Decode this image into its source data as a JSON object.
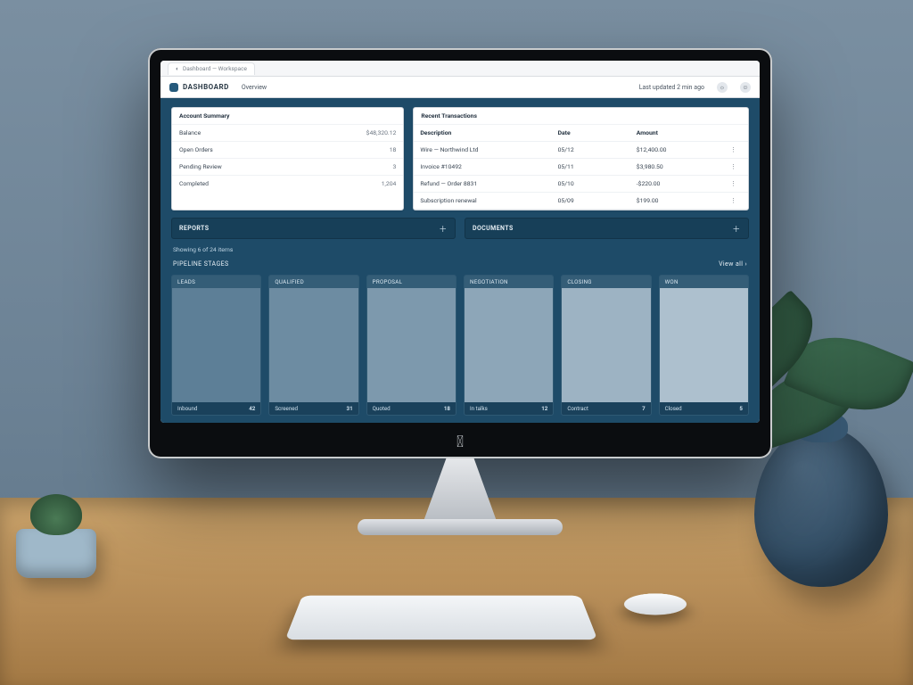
{
  "browser": {
    "tab_title": "Dashboard — Workspace"
  },
  "appbar": {
    "brand": "DASHBOARD",
    "nav1": "Overview",
    "status_text": "Last updated 2 min ago"
  },
  "summary_card": {
    "title": "Account Summary",
    "rows": [
      {
        "k": "Balance",
        "v": "$48,320.12"
      },
      {
        "k": "Open Orders",
        "v": "18"
      },
      {
        "k": "Pending Review",
        "v": "3"
      },
      {
        "k": "Completed",
        "v": "1,204"
      }
    ]
  },
  "activity_card": {
    "title": "Recent Transactions",
    "head": {
      "c1": "Description",
      "c2": "Date",
      "c3": "Amount",
      "c4": ""
    },
    "rows": [
      {
        "c1": "Wire — Northwind Ltd",
        "c2": "05/12",
        "c3": "$12,400.00"
      },
      {
        "c1": "Invoice #10492",
        "c2": "05/11",
        "c3": "$3,980.50"
      },
      {
        "c1": "Refund — Order 8831",
        "c2": "05/10",
        "c3": "-$220.00"
      },
      {
        "c1": "Subscription renewal",
        "c2": "05/09",
        "c3": "$199.00"
      }
    ]
  },
  "banner_left": {
    "label": "REPORTS"
  },
  "banner_right": {
    "label": "DOCUMENTS"
  },
  "sub_note": "Showing 6 of 24 items",
  "tiles_header": {
    "left": "PIPELINE STAGES",
    "right": "View all ›"
  },
  "tiles": [
    {
      "top": "LEADS",
      "name": "Inbound",
      "count": "42"
    },
    {
      "top": "QUALIFIED",
      "name": "Screened",
      "count": "31"
    },
    {
      "top": "PROPOSAL",
      "name": "Quoted",
      "count": "18"
    },
    {
      "top": "NEGOTIATION",
      "name": "In talks",
      "count": "12"
    },
    {
      "top": "CLOSING",
      "name": "Contract",
      "count": "7"
    },
    {
      "top": "WON",
      "name": "Closed",
      "count": "5"
    }
  ]
}
